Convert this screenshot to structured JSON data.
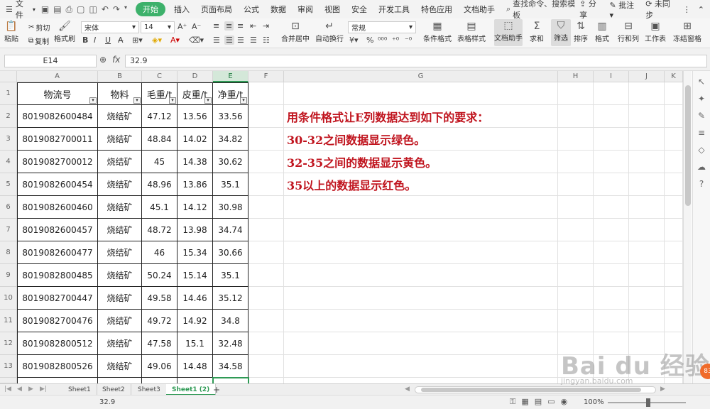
{
  "menubar": {
    "file": "文件",
    "tabs": [
      "开始",
      "插入",
      "页面布局",
      "公式",
      "数据",
      "审阅",
      "视图",
      "安全",
      "开发工具",
      "特色应用",
      "文档助手"
    ],
    "search": "查找命令、搜索模板",
    "share": "分享",
    "comment": "批注",
    "sync": "未同步"
  },
  "ribbon": {
    "paste": "粘贴",
    "cut": "剪切",
    "copy": "复制",
    "format_painter": "格式刷",
    "font_name": "宋体",
    "font_size": "14",
    "bold": "B",
    "italic": "I",
    "underline": "U",
    "merge": "合并居中",
    "wrap": "自动换行",
    "number_format": "常规",
    "percent": "%",
    "cond_format": "条件格式",
    "table_style": "表格样式",
    "doc_helper": "文档助手",
    "sum": "求和",
    "filter": "筛选",
    "sort": "排序",
    "format": "格式",
    "rows_cols": "行和列",
    "worksheet": "工作表",
    "freeze": "冻结窗格"
  },
  "formula_bar": {
    "cell_ref": "E14",
    "fx": "fx",
    "value": "32.9"
  },
  "columns": [
    "A",
    "B",
    "C",
    "D",
    "E",
    "F",
    "G",
    "H",
    "I",
    "J",
    "K"
  ],
  "rows": [
    "1",
    "2",
    "3",
    "4",
    "5",
    "6",
    "7",
    "8",
    "9",
    "10",
    "11",
    "12",
    "13"
  ],
  "table": {
    "headers": [
      "物流号",
      "物料",
      "毛重/t",
      "皮重/t",
      "净重/t"
    ],
    "data": [
      [
        "8019082600484",
        "烧结矿",
        "47.12",
        "13.56",
        "33.56"
      ],
      [
        "8019082700011",
        "烧结矿",
        "48.84",
        "14.02",
        "34.82"
      ],
      [
        "8019082700012",
        "烧结矿",
        "45",
        "14.38",
        "30.62"
      ],
      [
        "8019082600454",
        "烧结矿",
        "48.96",
        "13.86",
        "35.1"
      ],
      [
        "8019082600460",
        "烧结矿",
        "45.1",
        "14.12",
        "30.98"
      ],
      [
        "8019082600457",
        "烧结矿",
        "48.72",
        "13.98",
        "34.74"
      ],
      [
        "8019082600477",
        "烧结矿",
        "46",
        "15.34",
        "30.66"
      ],
      [
        "8019082800485",
        "烧结矿",
        "50.24",
        "15.14",
        "35.1"
      ],
      [
        "8019082700447",
        "烧结矿",
        "49.58",
        "14.46",
        "35.12"
      ],
      [
        "8019082700476",
        "烧结矿",
        "49.72",
        "14.92",
        "34.8"
      ],
      [
        "8019082800512",
        "烧结矿",
        "47.58",
        "15.1",
        "32.48"
      ],
      [
        "8019082800526",
        "烧结矿",
        "49.06",
        "14.48",
        "34.58"
      ]
    ]
  },
  "instructions": [
    "用条件格式让E列数据达到如下的要求：",
    "30-32之间数据显示绿色。",
    "32-35之间的数据显示黄色。",
    "35以上的数据显示红色。"
  ],
  "sheets": [
    "Sheet1",
    "Sheet2",
    "Sheet3",
    "Sheet1 (2)"
  ],
  "active_sheet": "Sheet1 (2)",
  "add_sheet": "+",
  "status": {
    "value": "32.9",
    "zoom": "100%"
  },
  "watermark": {
    "brand": "Bai du 经验",
    "url": "jingyan.baidu.com"
  },
  "badge": "83",
  "colors": {
    "accent": "#2f9a55",
    "instruction_text": "#c0141e"
  }
}
